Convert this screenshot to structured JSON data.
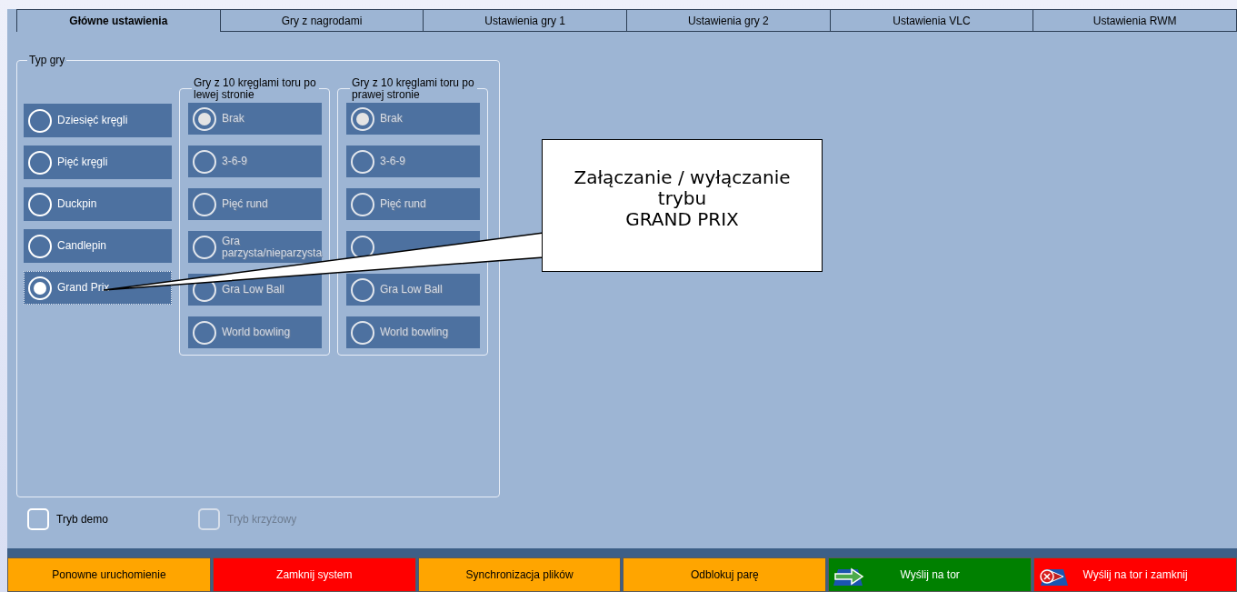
{
  "tabs": [
    {
      "label": "Główne ustawienia",
      "selected": true
    },
    {
      "label": "Gry z nagrodami",
      "selected": false
    },
    {
      "label": "Ustawienia gry 1",
      "selected": false
    },
    {
      "label": "Ustawienia gry 2",
      "selected": false
    },
    {
      "label": "Ustawienia VLC",
      "selected": false
    },
    {
      "label": "Ustawienia RWM",
      "selected": false
    }
  ],
  "game_type": {
    "title": "Typ gry",
    "options": [
      {
        "label": "Dziesięć kręgli",
        "selected": false
      },
      {
        "label": "Pięć kręgli",
        "selected": false
      },
      {
        "label": "Duckpin",
        "selected": false
      },
      {
        "label": "Candlepin",
        "selected": false
      },
      {
        "label": "Grand Prix",
        "selected": true
      }
    ],
    "groups": [
      {
        "title": "Gry z 10 kręglami toru po lewej stronie",
        "options": [
          {
            "label": "Brak",
            "selected": true,
            "disabled": true
          },
          {
            "label": "3-6-9",
            "selected": false,
            "disabled": true
          },
          {
            "label": "Pięć rund",
            "selected": false,
            "disabled": true
          },
          {
            "label": "Gra parzysta/nieparzysta",
            "selected": false,
            "disabled": true
          },
          {
            "label": "Gra Low Ball",
            "selected": false,
            "disabled": true
          },
          {
            "label": "World bowling",
            "selected": false,
            "disabled": true
          }
        ]
      },
      {
        "title": "Gry z 10 kręglami toru po prawej stronie",
        "options": [
          {
            "label": "Brak",
            "selected": true,
            "disabled": true
          },
          {
            "label": "3-6-9",
            "selected": false,
            "disabled": true
          },
          {
            "label": "Pięć rund",
            "selected": false,
            "disabled": true
          },
          {
            "selected": false,
            "disabled": true
          },
          {
            "label": "Gra Low Ball",
            "selected": false,
            "disabled": true
          },
          {
            "label": "World bowling",
            "selected": false,
            "disabled": true
          }
        ]
      }
    ]
  },
  "checkboxes": [
    {
      "label": "Tryb demo",
      "checked": false,
      "disabled": false
    },
    {
      "label": "Tryb krzyżowy",
      "checked": false,
      "disabled": true
    }
  ],
  "callout": {
    "text": "Załączanie / wyłączanie trybu\nGRAND PRIX"
  },
  "buttons": [
    {
      "label": "Ponowne uruchomienie",
      "color": "#ffa500"
    },
    {
      "label": "Zamknij system",
      "color": "#ff0000"
    },
    {
      "label": "Synchronizacja plików",
      "color": "#ffa500"
    },
    {
      "label": "Odblokuj parę",
      "color": "#ffa500"
    },
    {
      "label": "Wyślij na tor",
      "color": "#008000",
      "kind": "send"
    },
    {
      "label": "Wyślij na tor i zamknij",
      "color": "#ff0000",
      "kind": "send-close"
    }
  ]
}
